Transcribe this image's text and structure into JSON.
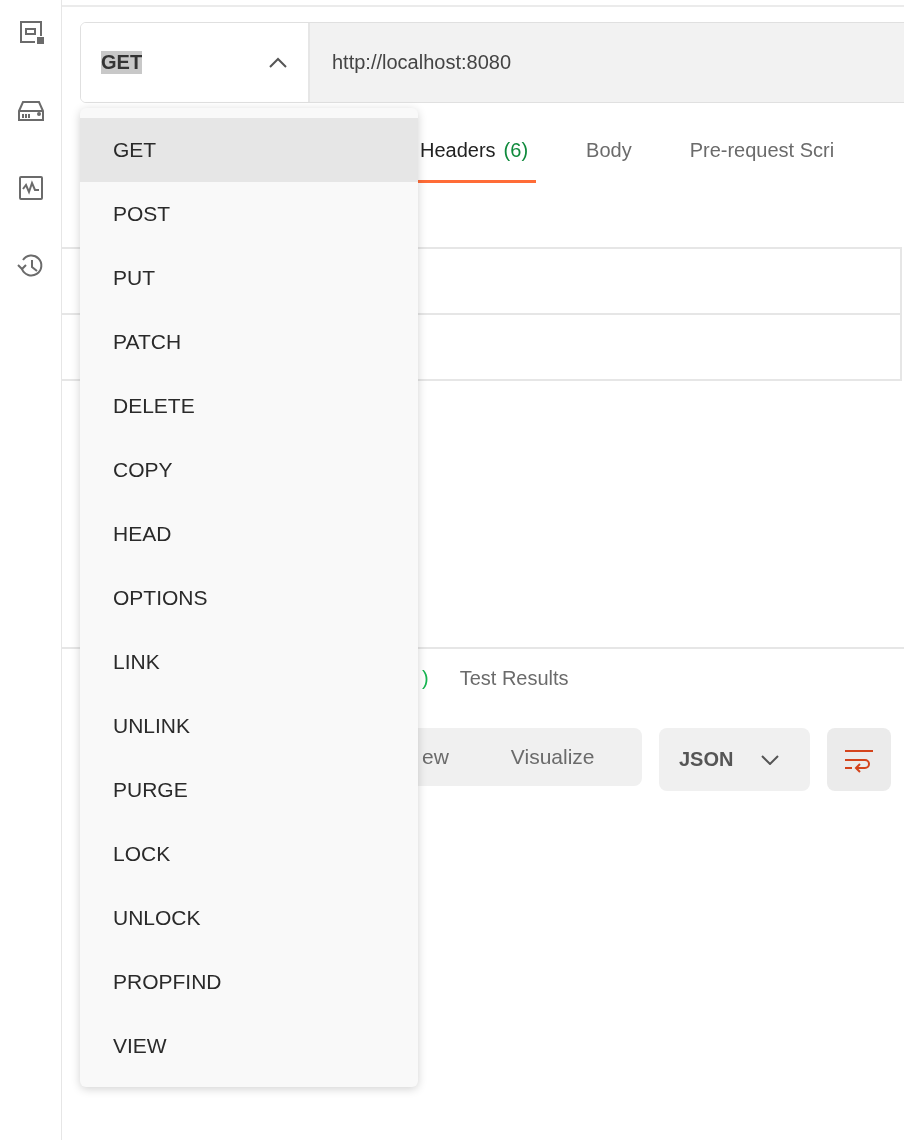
{
  "sidebar": {
    "items": [
      {
        "kind": "window"
      },
      {
        "kind": "drive"
      },
      {
        "kind": "monitor"
      },
      {
        "kind": "history"
      }
    ]
  },
  "request": {
    "method": "GET",
    "url": "http://localhost:8080"
  },
  "request_tabs": [
    {
      "label": "Headers",
      "count": "(6)",
      "selected": true
    },
    {
      "label": "Body",
      "selected": false
    },
    {
      "label": "Pre-request Scri",
      "selected": false
    }
  ],
  "response_tabs": [
    {
      "label": ")",
      "kind": "count",
      "selected": false
    },
    {
      "label": "Test Results",
      "kind": "tab",
      "selected": false
    }
  ],
  "view_modes": [
    {
      "label": "ew",
      "selected": false
    },
    {
      "label": "Visualize",
      "selected": false
    }
  ],
  "format": {
    "label": "JSON"
  },
  "method_menu": {
    "items": [
      {
        "label": "GET",
        "selected": true
      },
      {
        "label": "POST",
        "selected": false
      },
      {
        "label": "PUT",
        "selected": false
      },
      {
        "label": "PATCH",
        "selected": false
      },
      {
        "label": "DELETE",
        "selected": false
      },
      {
        "label": "COPY",
        "selected": false
      },
      {
        "label": "HEAD",
        "selected": false
      },
      {
        "label": "OPTIONS",
        "selected": false
      },
      {
        "label": "LINK",
        "selected": false
      },
      {
        "label": "UNLINK",
        "selected": false
      },
      {
        "label": "PURGE",
        "selected": false
      },
      {
        "label": "LOCK",
        "selected": false
      },
      {
        "label": "UNLOCK",
        "selected": false
      },
      {
        "label": "PROPFIND",
        "selected": false
      },
      {
        "label": "VIEW",
        "selected": false
      }
    ]
  }
}
